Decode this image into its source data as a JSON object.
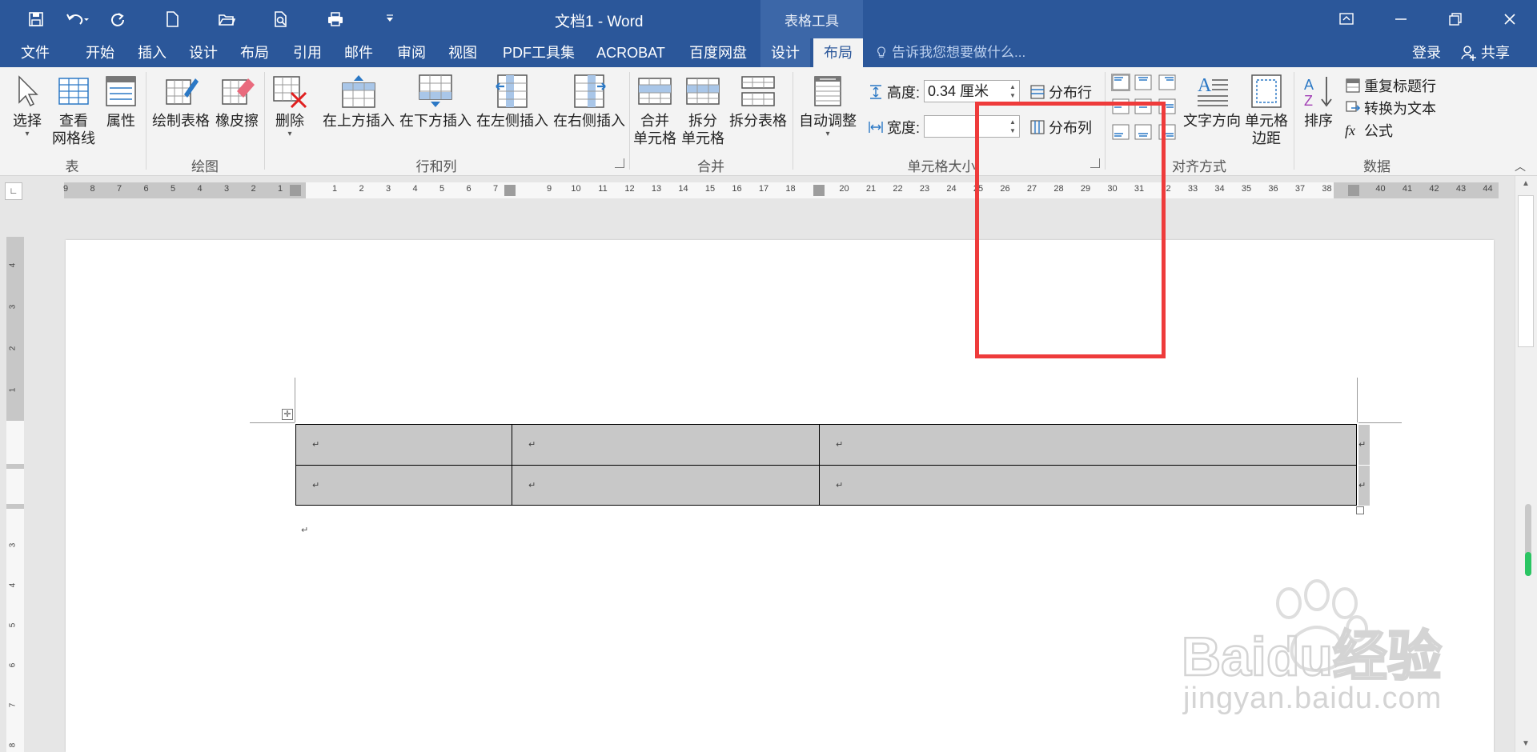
{
  "titlebar": {
    "title": "文档1 - Word",
    "context_title": "表格工具"
  },
  "tabs": {
    "file": "文件",
    "home": "开始",
    "insert": "插入",
    "design": "设计",
    "layout": "布局",
    "references": "引用",
    "mailings": "邮件",
    "review": "审阅",
    "view": "视图",
    "pdf": "PDF工具集",
    "acrobat": "ACROBAT",
    "baidu": "百度网盘",
    "table_design": "设计",
    "table_layout": "布局",
    "tell_me": "告诉我您想要做什么...",
    "login": "登录",
    "share": "共享"
  },
  "ribbon": {
    "select": "选择",
    "view_grid_1": "查看",
    "view_grid_2": "网格线",
    "properties": "属性",
    "group_table": "表",
    "draw_table": "绘制表格",
    "eraser": "橡皮擦",
    "group_draw": "绘图",
    "delete": "删除",
    "insert_above": "在上方插入",
    "insert_below": "在下方插入",
    "insert_left": "在左侧插入",
    "insert_right": "在右侧插入",
    "group_rows_cols": "行和列",
    "merge_1": "合并",
    "merge_2": "单元格",
    "split_1": "拆分",
    "split_2": "单元格",
    "split_table": "拆分表格",
    "group_merge": "合并",
    "autofit": "自动调整",
    "height_label": "高度:",
    "height_value": "0.34 厘米",
    "width_label": "宽度:",
    "width_value": "",
    "distribute_rows": "分布行",
    "distribute_cols": "分布列",
    "group_cell_size": "单元格大小",
    "text_direction": "文字方向",
    "cell_margin_1": "单元格",
    "cell_margin_2": "边距",
    "group_alignment": "对齐方式",
    "sort": "排序",
    "repeat_header": "重复标题行",
    "convert_text": "转换为文本",
    "formula": "公式",
    "group_data": "数据"
  },
  "document": {
    "rows": [
      [
        "↵",
        "↵",
        "↵"
      ],
      [
        "↵",
        "↵",
        "↵"
      ]
    ],
    "row_end": "↵",
    "para_mark": "↵",
    "move_handle": "✛"
  },
  "watermark": {
    "text": "jingyan.baidu.com",
    "logo_text": "Baidu经验"
  },
  "colors": {
    "accent": "#2b579a",
    "highlight": "#ee3b3b",
    "cell_shading": "#c8c8c8"
  }
}
